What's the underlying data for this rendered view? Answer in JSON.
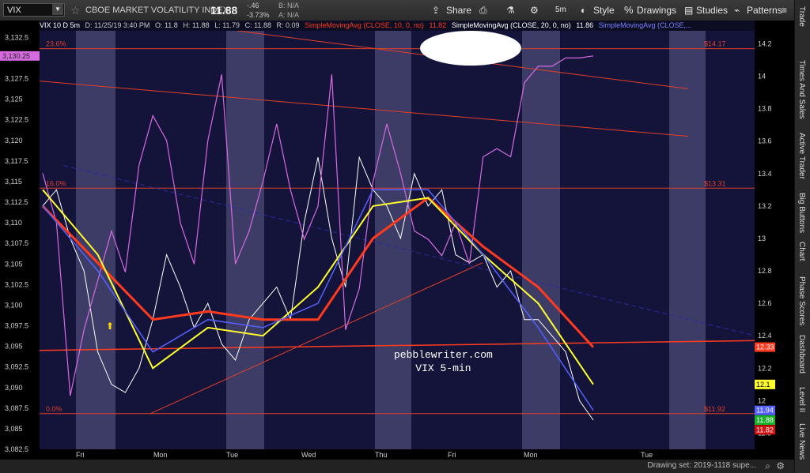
{
  "toolbar": {
    "symbol": "VIX",
    "symbol_name": "CBOE MARKET VOLATILITY INDEX",
    "last": "11.88",
    "change": "-.46",
    "change_pct": "-3.73%",
    "bid": "B: N/A",
    "ask": "A: N/A",
    "share": "Share",
    "timeframe": "5m",
    "style": "Style",
    "drawings": "Drawings",
    "studies": "Studies",
    "patterns": "Patterns"
  },
  "header": {
    "label": "VIX 10 D 5m",
    "date": "D: 11/25/19 3:40 PM",
    "open": "O: 11.8",
    "high": "H: 11.88",
    "low": "L: 11.79",
    "close": "C: 11.88",
    "range": "R: 0.09",
    "sma10": "SimpleMovingAvg (CLOSE, 10, 0, no)",
    "sma10_val": "11.82",
    "sma20": "SimpleMovingAvg (CLOSE, 20, 0, no)",
    "sma20_val": "11.86",
    "sma_clipped": "SimpleMovingAvg (CLOSE,..."
  },
  "chart_data": {
    "type": "line",
    "x_labels": [
      "Fri",
      "Mon",
      "Tue",
      "Wed",
      "Thu",
      "Fri",
      "Mon",
      "Tue"
    ],
    "y_left_ticks": [
      "3,132.5",
      "3,130",
      "3,127.5",
      "3,125",
      "3,122.5",
      "3,120",
      "3,117.5",
      "3,115",
      "3,112.5",
      "3,110",
      "3,107.5",
      "3,105",
      "3,102.5",
      "3,100",
      "3,097.5",
      "3,095",
      "3,092.5",
      "3,090",
      "3,087.5",
      "3,085",
      "3,082.5"
    ],
    "y_right_ticks": [
      "14.2",
      "14",
      "13.8",
      "13.6",
      "13.4",
      "13.2",
      "13",
      "12.8",
      "12.6",
      "12.4",
      "12.2",
      "12",
      "11.8"
    ],
    "ylim_right": [
      11.7,
      14.28
    ],
    "ylim_left": [
      3082.5,
      3133.3
    ],
    "spx_marker": "3,130.25",
    "fib_levels": [
      {
        "label": "23.6%",
        "price": "$14.17",
        "value": 14.17
      },
      {
        "label": "16.0%",
        "price": "$13.31",
        "value": 13.31
      },
      {
        "label": "0.0%",
        "price": "$11.92",
        "value": 11.92
      }
    ],
    "price_tags": [
      {
        "text": "12.33",
        "value": 12.33,
        "color": "#ff3a1e"
      },
      {
        "text": "12.1",
        "value": 12.1,
        "color": "#ffff2e"
      },
      {
        "text": "11.94",
        "value": 11.94,
        "color": "#5560ff"
      },
      {
        "text": "11.88",
        "value": 11.88,
        "color": "#19b02a"
      },
      {
        "text": "11.82",
        "value": 11.82,
        "color": "#d01010"
      }
    ],
    "series": [
      {
        "name": "VIX 5m close",
        "color": "#ffffff",
        "x": [
          0,
          0.5,
          1,
          1.5,
          2,
          2.5,
          3,
          3.5,
          4,
          4.5,
          5,
          5.5,
          6,
          6.5,
          7,
          7.5,
          8,
          8.5,
          9,
          9.5,
          10,
          10.5,
          11,
          11.5,
          12,
          12.5,
          13,
          13.5,
          14,
          14.5,
          15,
          15.5,
          16,
          16.5,
          17,
          17.5,
          18,
          18.5,
          19,
          19.5,
          20
        ],
        "y": [
          13.2,
          13.3,
          13.0,
          12.8,
          12.3,
          12.1,
          12.05,
          12.2,
          12.5,
          12.9,
          12.7,
          12.45,
          12.6,
          12.35,
          12.25,
          12.5,
          12.6,
          12.7,
          12.5,
          13.1,
          13.5,
          13.0,
          12.7,
          13.5,
          13.3,
          13.2,
          13.0,
          13.4,
          13.2,
          13.3,
          12.9,
          12.85,
          12.9,
          12.7,
          12.8,
          12.5,
          12.5,
          12.4,
          12.3,
          12.0,
          11.88
        ]
      },
      {
        "name": "SPX",
        "color": "#d66be0",
        "x": [
          0,
          0.5,
          1,
          1.5,
          2,
          2.5,
          3,
          3.5,
          4,
          4.5,
          5,
          5.5,
          6,
          6.5,
          7,
          7.5,
          8,
          8.5,
          9,
          9.5,
          10,
          10.5,
          11,
          11.5,
          12,
          12.5,
          13,
          13.5,
          14,
          14.5,
          15,
          15.5,
          16,
          16.5,
          17,
          17.5,
          18,
          18.5,
          19,
          19.5,
          20
        ],
        "y": [
          3116,
          3110,
          3089,
          3097,
          3103,
          3109,
          3104,
          3117,
          3123,
          3120,
          3110,
          3105,
          3120,
          3128,
          3105,
          3109,
          3115,
          3122,
          3114,
          3108,
          3112,
          3128,
          3097,
          3102,
          3115,
          3122,
          3116,
          3109,
          3108,
          3106,
          3110,
          3105,
          3118,
          3119,
          3118,
          3127,
          3129,
          3129,
          3130,
          3130,
          3130.25
        ]
      },
      {
        "name": "SimpleMovingAvg 10",
        "color": "#ff3a1e",
        "x": [
          0,
          2,
          4,
          6,
          8,
          10,
          12,
          14,
          16,
          18,
          20
        ],
        "y": [
          13.2,
          12.85,
          12.5,
          12.55,
          12.5,
          12.5,
          13.0,
          13.25,
          12.95,
          12.7,
          12.33
        ]
      },
      {
        "name": "SimpleMovingAvg 20",
        "color": "#ffff2e",
        "x": [
          0,
          2,
          4,
          6,
          8,
          10,
          12,
          14,
          16,
          18,
          20
        ],
        "y": [
          13.3,
          12.9,
          12.2,
          12.45,
          12.4,
          12.7,
          13.2,
          13.25,
          12.9,
          12.6,
          12.1
        ]
      },
      {
        "name": "SimpleMovingAvg 5",
        "color": "#5560ff",
        "x": [
          0,
          2,
          4,
          6,
          8,
          10,
          12,
          14,
          16,
          18,
          20
        ],
        "y": [
          13.2,
          12.8,
          12.3,
          12.5,
          12.45,
          12.6,
          13.3,
          13.3,
          12.9,
          12.45,
          11.94
        ]
      }
    ]
  },
  "watermark": {
    "line1": "pebblewriter.com",
    "line2": "VIX 5-min"
  },
  "bottom": {
    "drawing_set": "Drawing set: 2019-1118 supe..."
  },
  "sidebar": {
    "tabs": [
      "Trade",
      "Times And Sales",
      "Active Trader",
      "Big Buttons",
      "Chart",
      "Phase Scores",
      "Dashboard",
      "Level II",
      "Live News"
    ]
  }
}
